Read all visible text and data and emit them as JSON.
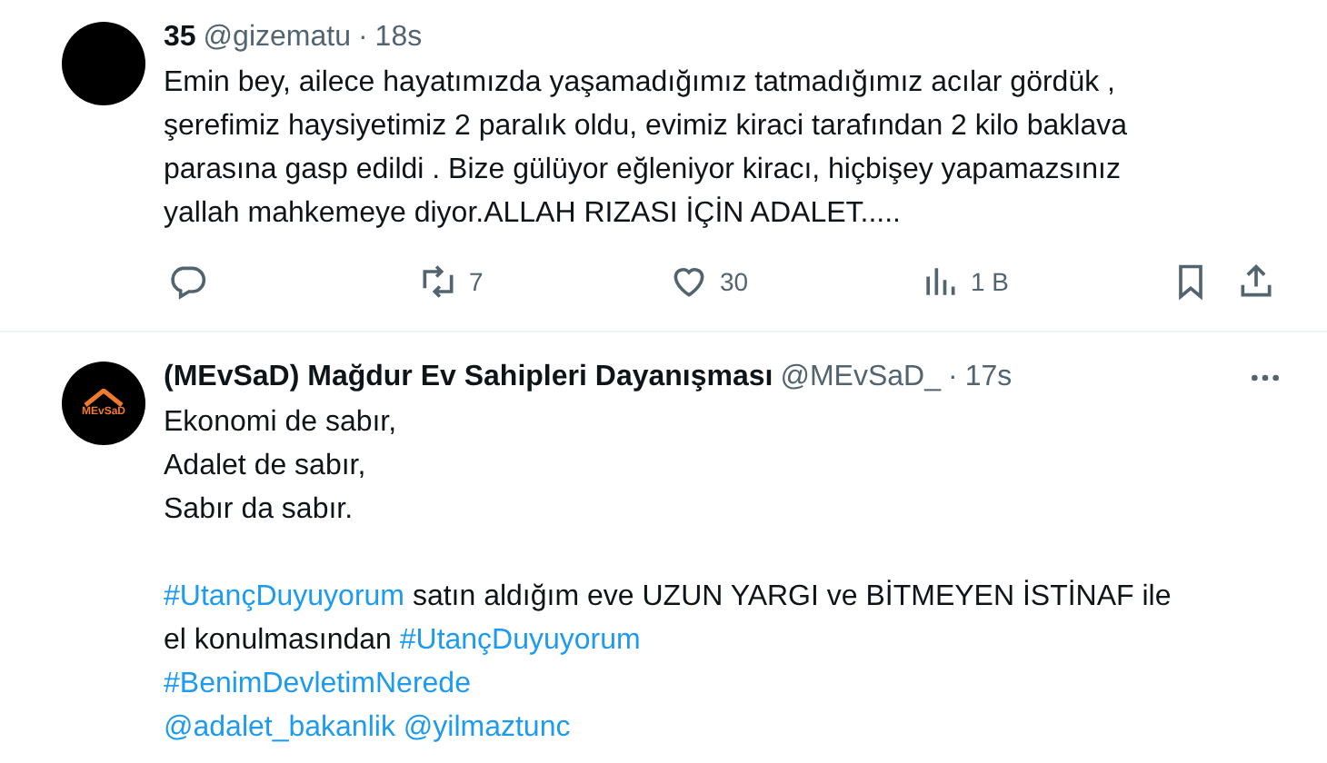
{
  "tweets": [
    {
      "name": "35",
      "handle": "@gizematu",
      "separator": "·",
      "time": "18s",
      "avatar": {
        "kind": "plain"
      },
      "text_lines": [
        "Emin bey, ailece hayatımızda yaşamadığımız tatmadığımız acılar gördük ,",
        "şerefimiz haysiyetimiz 2 paralık oldu, evimiz kiraci tarafından 2 kilo baklava",
        "parasına gasp edildi . Bize gülüyor eğleniyor kiracı, hiçbişey yapamazsınız",
        "yallah mahkemeye diyor.ALLAH RIZASI İÇİN ADALET....."
      ],
      "actions": {
        "retweets": "7",
        "likes": "30",
        "views": "1 B"
      }
    },
    {
      "name": "(MEvSaD) Mağdur Ev Sahipleri Dayanışması",
      "handle": "@MEvSaD_",
      "separator": "·",
      "time": "17s",
      "more": true,
      "avatar": {
        "kind": "logo",
        "logo_text": "MEvSaD"
      },
      "text_lines": [
        "Ekonomi de sabır,",
        "Adalet de sabır,",
        "Sabır da sabır."
      ],
      "paragraphs": [
        [
          [
            {
              "kind": "hashtag",
              "text": "#UtançDuyuyorum"
            },
            {
              "kind": "text",
              "text": " satın aldığım eve UZUN YARGI ve BİTMEYEN İSTİNAF ile"
            }
          ],
          [
            {
              "kind": "text",
              "text": "el konulmasından "
            },
            {
              "kind": "hashtag",
              "text": "#UtançDuyuyorum"
            }
          ],
          [
            {
              "kind": "hashtag",
              "text": "#BenimDevletimNerede"
            }
          ],
          [
            {
              "kind": "mention",
              "text": "@adalet_bakanlik"
            },
            {
              "kind": "space"
            },
            {
              "kind": "mention",
              "text": "@yilmaztunc"
            }
          ]
        ]
      ]
    }
  ]
}
